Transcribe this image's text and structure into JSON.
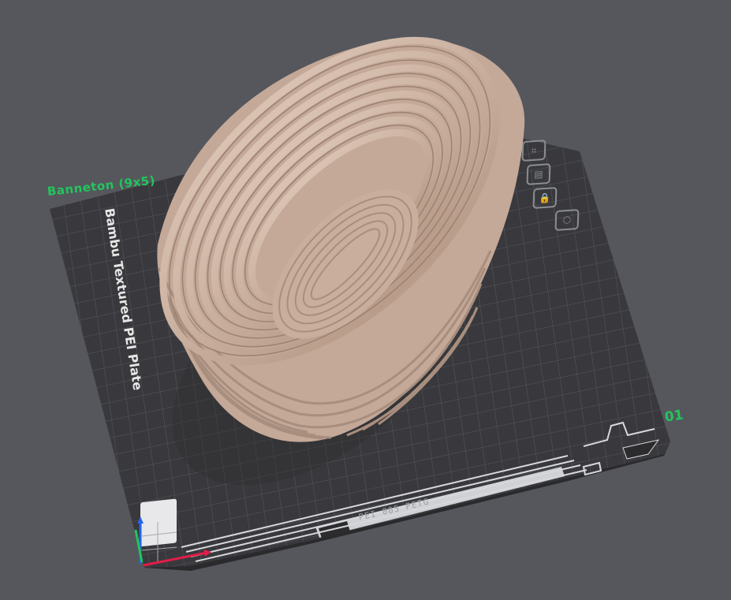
{
  "plate": {
    "name": "Banneton (9x5)",
    "number": "01",
    "type_label": "Bambu Textured PEI Plate",
    "code": "PEI 005 PETG"
  },
  "model": {
    "name": "Banneton (9x5)",
    "color": "#d2b8a8"
  },
  "side_tools": [
    {
      "name": "arrange-icon",
      "glyph": "⌗"
    },
    {
      "name": "orient-icon",
      "glyph": "▤"
    },
    {
      "name": "lock-icon",
      "glyph": "🔒"
    },
    {
      "name": "settings-icon",
      "glyph": "⬡"
    }
  ],
  "colors": {
    "background": "#55575c",
    "plate": "#3a3b3f",
    "label_green": "#22c55e",
    "axis_x": "#e11d48",
    "axis_y": "#22c55e",
    "axis_z": "#2563eb"
  }
}
